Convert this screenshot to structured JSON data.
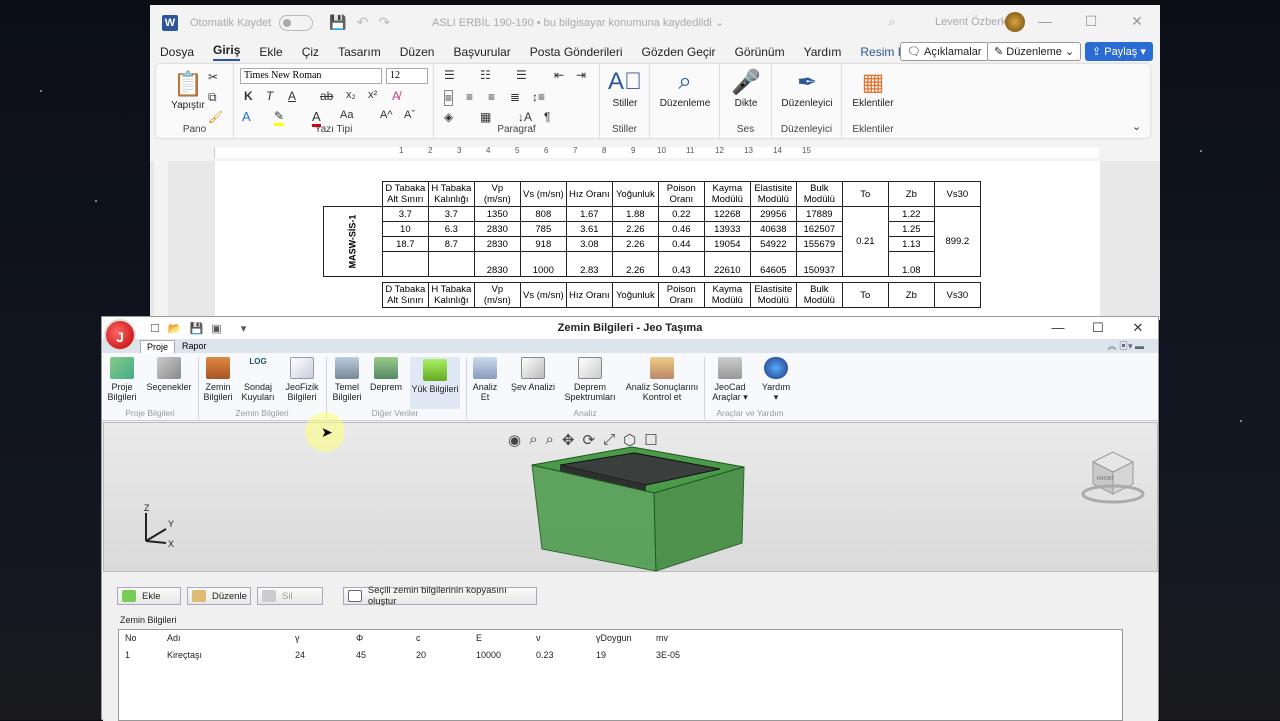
{
  "word": {
    "autosave": "Otomatik Kaydet",
    "doc_title": "ASLI ERBİL 190-190  •  bu bilgisayar konumuna kaydedildi ⌄",
    "user": "Levent Özberk",
    "menus": [
      "Dosya",
      "Giriş",
      "Ekle",
      "Çiz",
      "Tasarım",
      "Düzen",
      "Başvurular",
      "Posta Gönderileri",
      "Gözden Geçir",
      "Görünüm",
      "Yardım",
      "Resim Biçimi"
    ],
    "comments_btn": "Açıklamalar",
    "edit_btn": "Düzenleme",
    "share_btn": "Paylaş",
    "ribbon": {
      "paste": "Yapıştır",
      "font_name": "Times New Roman",
      "font_size": "12",
      "styles": "Stiller",
      "editing": "Düzenleme",
      "dictate": "Dikte",
      "editor": "Düzenleyici",
      "addins": "Eklentiler",
      "groups": [
        "Pano",
        "Yazı Tipi",
        "Paragraf",
        "Stiller",
        "Ses",
        "Düzenleyici",
        "Eklentiler"
      ]
    },
    "ruler_nums": [
      "1",
      "2",
      "3",
      "4",
      "5",
      "6",
      "7",
      "8",
      "9",
      "10",
      "11",
      "12",
      "13",
      "14",
      "15"
    ],
    "table": {
      "side_label": "MASW-SİS-1",
      "headers": [
        "D Tabaka Alt Sınırı",
        "H Tabaka Kalınlığı",
        "Vp (m/sn)",
        "Vs (m/sn)",
        "Hız Oranı",
        "Yoğunluk",
        "Poison Oranı",
        "Kayma Modülü",
        "Elastisite Modülü",
        "Bulk Modülü",
        "To",
        "Zb",
        "Vs30"
      ],
      "rows": [
        [
          "3.7",
          "3.7",
          "1350",
          "808",
          "1.67",
          "1.88",
          "0.22",
          "12268",
          "29956",
          "17889",
          "1.22"
        ],
        [
          "10",
          "6.3",
          "2830",
          "785",
          "3.61",
          "2.26",
          "0.46",
          "13933",
          "40638",
          "162507",
          "1.25"
        ],
        [
          "18.7",
          "8.7",
          "2830",
          "918",
          "3.08",
          "2.26",
          "0.44",
          "19054",
          "54922",
          "155679",
          "1.13"
        ],
        [
          "",
          "",
          "2830",
          "1000",
          "2.83",
          "2.26",
          "0.43",
          "22610",
          "64605",
          "150937",
          "1.08"
        ]
      ],
      "to": "0.21",
      "vs30": "899.2",
      "headers2": [
        "D Tabaka Alt Sınırı",
        "H Tabaka Kalınlığı",
        "Vp (m/sn)",
        "Vs (m/sn)",
        "Hız Oranı",
        "Yoğunluk",
        "Poison Oranı",
        "Kayma Modülü",
        "Elastisite Modülü",
        "Bulk Modülü",
        "To",
        "Zb",
        "Vs30"
      ]
    }
  },
  "jeo": {
    "title": "Zemin Bilgileri - Jeo Taşıma",
    "tabs": [
      "Proje",
      "Rapor"
    ],
    "buttons": [
      {
        "label": "Proje\nBilgileri"
      },
      {
        "label": "Seçenekler"
      },
      {
        "label": "Zemin\nBilgileri"
      },
      {
        "label": "Sondaj\nKuyuları"
      },
      {
        "label": "JeoFizik\nBilgileri"
      },
      {
        "label": "Temel\nBilgileri"
      },
      {
        "label": "Deprem"
      },
      {
        "label": "Yük Bilgileri"
      },
      {
        "label": "Analiz\nEt"
      },
      {
        "label": "Şev Analizi"
      },
      {
        "label": "Deprem\nSpektrumları"
      },
      {
        "label": "Analiz Sonuçlarını\nKontrol et"
      },
      {
        "label": "JeoCad\nAraçlar ▾"
      },
      {
        "label": "Yardım\n▾"
      }
    ],
    "groups": [
      "Proje Bilgileri",
      "Zemin Bilgileri",
      "Diğer Veriler",
      "Analiz",
      "Araçlar ve Yardım"
    ],
    "bottom_buttons": {
      "add": "Ekle",
      "edit": "Düzenle",
      "delete": "Sil",
      "copy": "Seçili zemin bilgilerinin kopyasını oluştur"
    },
    "section_label": "Zemin Bilgileri",
    "grid_headers": [
      "No",
      "Adı",
      "γ",
      "Φ",
      "c",
      "E",
      "ν",
      "γDoygun",
      "mv"
    ],
    "grid_rows": [
      [
        "1",
        "Kireçtaşı",
        "24",
        "45",
        "20",
        "10000",
        "0.23",
        "19",
        "3E-05"
      ]
    ],
    "log_label": "LOG",
    "axes": {
      "z": "Z",
      "y": "Y",
      "x": "X"
    },
    "cube_face": "FRONT"
  }
}
